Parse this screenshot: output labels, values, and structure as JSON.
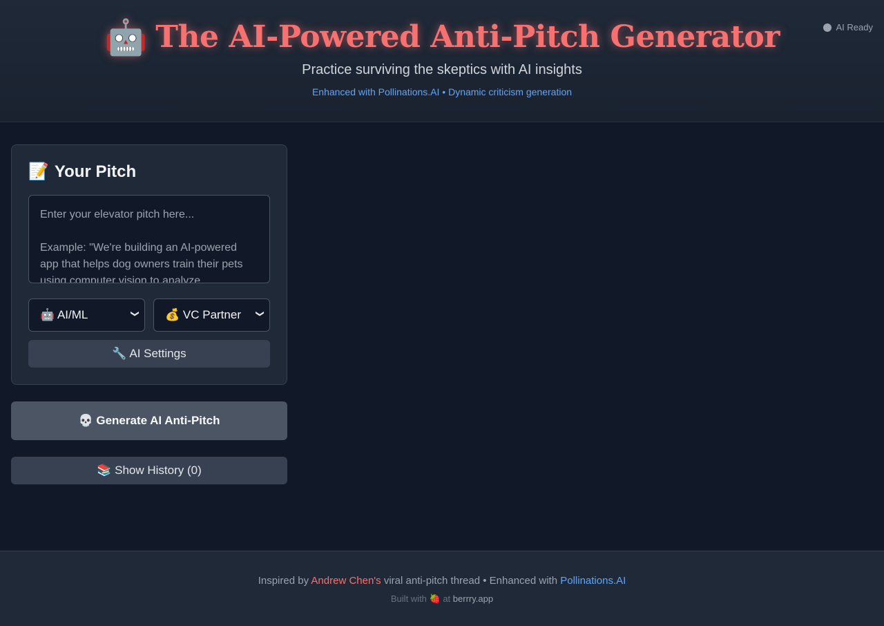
{
  "header": {
    "status_label": "AI Ready",
    "title_icon": "🤖",
    "title": "The AI-Powered Anti-Pitch Generator",
    "subtitle": "Practice surviving the skeptics with AI insights",
    "tagline": "Enhanced with Pollinations.AI • Dynamic criticism generation"
  },
  "pitch_card": {
    "heading_icon": "📝",
    "heading": "Your Pitch",
    "textarea_placeholder": "Enter your elevator pitch here...\n\nExample: \"We're building an AI-powered app that helps dog owners train their pets using computer vision to analyze",
    "industry_select": {
      "selected": "🤖 AI/ML"
    },
    "persona_select": {
      "selected": "💰 VC Partner"
    },
    "settings_button": "🔧 AI Settings"
  },
  "actions": {
    "generate_button": "💀 Generate AI Anti-Pitch",
    "history_button": "📚 Show History (0)"
  },
  "footer": {
    "line1_prefix": "Inspired by ",
    "line1_author": "Andrew Chen's",
    "line1_middle": " viral anti-pitch thread • Enhanced with ",
    "line1_link": "Pollinations.AI",
    "line2_prefix": "Built with ",
    "line2_icon": "🍓",
    "line2_middle": " at ",
    "line2_link": "berrry.app"
  },
  "colors": {
    "background": "#111827",
    "panel": "#1f2937",
    "accent_red": "#f87171",
    "accent_blue": "#60a5fa"
  }
}
